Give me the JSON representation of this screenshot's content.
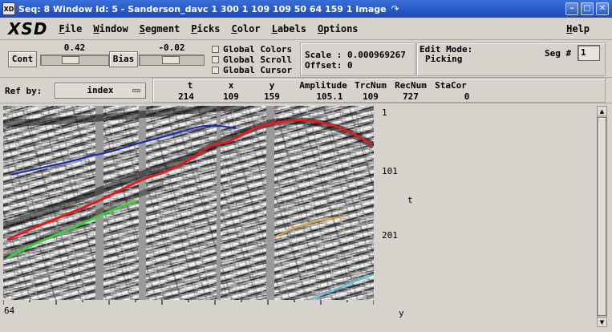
{
  "window": {
    "app_icon": "XD",
    "title": "Seq: 8 Window Id: 5 - Sanderson_davc 1 300 1 109 109 50 64 159 1 Image"
  },
  "menubar": {
    "logo": "XSD",
    "items": [
      "File",
      "Window",
      "Segment",
      "Picks",
      "Color",
      "Labels",
      "Options"
    ],
    "help": "Help"
  },
  "controls": {
    "cont": {
      "label": "Cont",
      "value": "0.42",
      "fraction": 0.42
    },
    "bias": {
      "label": "Bias",
      "value": "-0.02",
      "fraction": 0.49
    },
    "checks": [
      "Global Colors",
      "Global Scroll",
      "Global Cursor"
    ],
    "scale_label": "Scale : 0.000969267",
    "offset_label": "Offset: 0",
    "edit_mode_label": "Edit Mode:",
    "edit_mode_value": "Picking",
    "seg_label": "Seg #",
    "seg_value": "1"
  },
  "info": {
    "ref_by_label": "Ref by:",
    "ref_by_value": "index",
    "headers": [
      "t",
      "x",
      "y",
      "Amplitude",
      "TrcNum",
      "RecNum",
      "StaCor"
    ],
    "values": [
      "214",
      "109",
      "159",
      "105.1",
      "109",
      "727",
      "0"
    ]
  },
  "plot": {
    "y_ticks": [
      "1",
      "101",
      "201"
    ],
    "y_axis_label": "t",
    "x_start": "64",
    "x_axis_label": "y"
  },
  "colors": {
    "pick_blue": "#1c26b8",
    "pick_red": "#e01c1c",
    "pick_green": "#3ccc3c",
    "pick_orange": "#e0a040",
    "pick_cyan": "#50c8e8"
  }
}
